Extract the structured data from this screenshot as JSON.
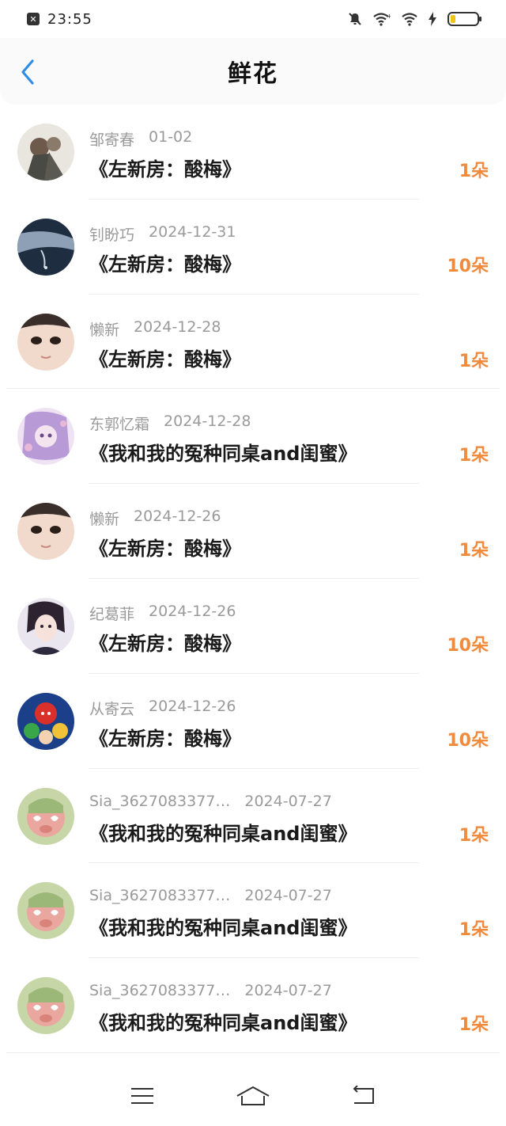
{
  "status_bar": {
    "time": "23:55",
    "app_icon_glyph": "✕",
    "battery_color": "#f2c21a",
    "battery_level": 0.2
  },
  "header": {
    "title": "鲜花",
    "back_icon": "chevron-left-icon"
  },
  "colors": {
    "accent_back": "#2f8de4",
    "count_color": "#f08a3c",
    "meta_color": "#9a9a9a"
  },
  "items": [
    {
      "name": "邹寄春",
      "date": "01-02",
      "title": "《左新房：酸梅》",
      "count": "1朵"
    },
    {
      "name": "钊盼巧",
      "date": "2024-12-31",
      "title": "《左新房：酸梅》",
      "count": "10朵"
    },
    {
      "name": "懒新",
      "date": "2024-12-28",
      "title": "《左新房：酸梅》",
      "count": "1朵"
    },
    {
      "name": "东郭忆霜",
      "date": "2024-12-28",
      "title": "《我和我的冤种同桌and闺蜜》",
      "count": "1朵"
    },
    {
      "name": "懒新",
      "date": "2024-12-26",
      "title": "《左新房：酸梅》",
      "count": "1朵"
    },
    {
      "name": "纪葛菲",
      "date": "2024-12-26",
      "title": "《左新房：酸梅》",
      "count": "10朵"
    },
    {
      "name": "从寄云",
      "date": "2024-12-26",
      "title": "《左新房：酸梅》",
      "count": "10朵"
    },
    {
      "name": "Sia_3627083377…",
      "date": "2024-07-27",
      "title": "《我和我的冤种同桌and闺蜜》",
      "count": "1朵"
    },
    {
      "name": "Sia_3627083377…",
      "date": "2024-07-27",
      "title": "《我和我的冤种同桌and闺蜜》",
      "count": "1朵"
    },
    {
      "name": "Sia_3627083377…",
      "date": "2024-07-27",
      "title": "《我和我的冤种同桌and闺蜜》",
      "count": "1朵"
    }
  ],
  "nav": {
    "menu_icon": "menu-icon",
    "home_icon": "home-icon",
    "back_icon": "back-arrow-icon"
  }
}
